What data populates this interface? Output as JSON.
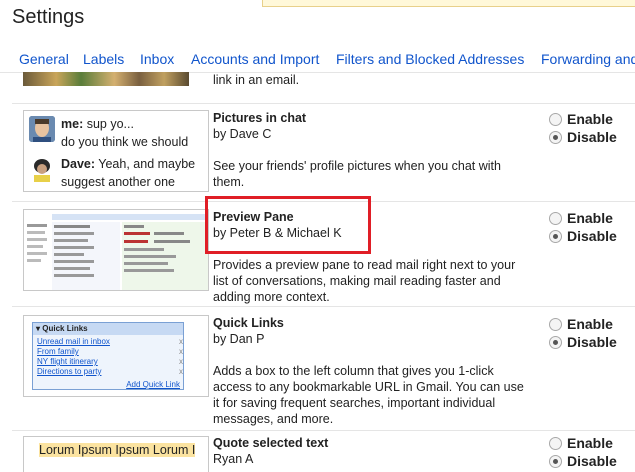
{
  "header": {
    "title": "Settings"
  },
  "tabs": [
    {
      "label": "General"
    },
    {
      "label": "Labels"
    },
    {
      "label": "Inbox"
    },
    {
      "label": "Accounts and Import"
    },
    {
      "label": "Filters and Blocked Addresses"
    },
    {
      "label": "Forwarding and"
    }
  ],
  "prev_row": {
    "tail_text": "link in an email."
  },
  "labs": [
    {
      "name": "Pictures in chat",
      "author": "by Dave C",
      "description": "See your friends' profile pictures when you chat with them.",
      "enable_label": "Enable",
      "disable_label": "Disable",
      "selected": "disable",
      "thumb": {
        "lines": [
          "me: sup yo...",
          "do you think we should",
          "Dave: Yeah, and maybe",
          "suggest another one"
        ],
        "chat": [
          {
            "speaker": "me:",
            "text": " sup yo..."
          },
          {
            "speaker": "",
            "text": "do you think we should"
          },
          {
            "speaker": "Dave:",
            "text": " Yeah, and maybe"
          },
          {
            "speaker": "",
            "text": "suggest another one"
          }
        ]
      }
    },
    {
      "name": "Preview Pane",
      "author": "by Peter B & Michael K",
      "description": "Provides a preview pane to read mail right next to your list of conversations, making mail reading faster and adding more context.",
      "enable_label": "Enable",
      "disable_label": "Disable",
      "selected": "disable",
      "highlighted": true
    },
    {
      "name": "Quick Links",
      "author": "by Dan P",
      "description": "Adds a box to the left column that gives you 1-click access to any bookmarkable URL in Gmail. You can use it for saving frequent searches, important individual messages, and more.",
      "enable_label": "Enable",
      "disable_label": "Disable",
      "selected": "disable",
      "thumb": {
        "title": "Quick Links",
        "items": [
          "Unread mail in inbox",
          "From family",
          "NY flight itinerary",
          "Directions to party"
        ],
        "add_label": "Add Quick Link"
      }
    },
    {
      "name": "Quote selected text",
      "author": "Ryan A",
      "enable_label": "Enable",
      "disable_label": "Disable",
      "selected": "disable",
      "thumb": {
        "text": "Lorum Ipsum Ipsum Lorum I"
      }
    }
  ],
  "colors": {
    "link": "#1155cc",
    "highlight": "#e01e26",
    "divider": "#e5e5e5"
  }
}
